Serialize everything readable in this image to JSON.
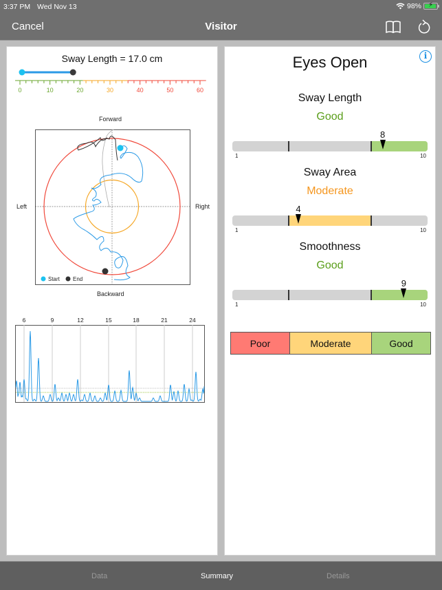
{
  "status_bar": {
    "time": "3:37 PM",
    "date": "Wed Nov 13",
    "battery": "98%",
    "icons": [
      "wifi-icon",
      "battery-charging-icon"
    ]
  },
  "nav": {
    "cancel": "Cancel",
    "title": "Visitor",
    "icons": [
      "book-icon",
      "refresh-icon"
    ]
  },
  "left_panel": {
    "sway_title": "Sway Length = 17.0 cm",
    "slider": {
      "min": 0,
      "max": 60,
      "start": 0,
      "value": 17.0
    },
    "scale": {
      "ticks": [
        {
          "label": "0",
          "value": 0,
          "color": "#6aa62e"
        },
        {
          "label": "10",
          "value": 10,
          "color": "#6aa62e"
        },
        {
          "label": "20",
          "value": 20,
          "color": "#6aa62e"
        },
        {
          "label": "30",
          "value": 30,
          "color": "#f5a623"
        },
        {
          "label": "40",
          "value": 40,
          "color": "#f0483a"
        },
        {
          "label": "50",
          "value": 50,
          "color": "#f0483a"
        },
        {
          "label": "60",
          "value": 60,
          "color": "#f0483a"
        }
      ],
      "zones": [
        {
          "from": 0,
          "to": 21,
          "color": "#6aa62e"
        },
        {
          "from": 21,
          "to": 36,
          "color": "#f5a623"
        },
        {
          "from": 36,
          "to": 62,
          "color": "#f0483a"
        }
      ]
    },
    "sway_plot": {
      "labels": {
        "top": "Forward",
        "bottom": "Backward",
        "left": "Left",
        "right": "Right"
      },
      "legend": {
        "start": "Start",
        "end": "End"
      },
      "colors": {
        "outer": "#f0483a",
        "inner": "#f5a623",
        "path": "#2b9ae6",
        "start": "#1cc2f0",
        "end": "#333333"
      }
    },
    "fft_chart": {
      "x_ticks": [
        "6",
        "9",
        "12",
        "15",
        "18",
        "21",
        "24"
      ],
      "line_color": "#2b9ae6"
    }
  },
  "right_panel": {
    "title": "Eyes Open",
    "info_icon": "i",
    "metrics": [
      {
        "name": "Sway Length",
        "rating": "Good",
        "rating_color": "#5a9e1a",
        "value": 8,
        "value_label": "8",
        "zone": "good",
        "min_label": "1",
        "max_label": "10"
      },
      {
        "name": "Sway Area",
        "rating": "Moderate",
        "rating_color": "#f5961e",
        "value": 4,
        "value_label": "4",
        "zone": "moderate",
        "min_label": "1",
        "max_label": "10"
      },
      {
        "name": "Smoothness",
        "rating": "Good",
        "rating_color": "#5a9e1a",
        "value": 9,
        "value_label": "9",
        "zone": "good",
        "min_label": "1",
        "max_label": "10"
      }
    ],
    "legend": [
      {
        "label": "Poor",
        "color": "#ff7a73"
      },
      {
        "label": "Moderate",
        "color": "#ffd57a"
      },
      {
        "label": "Good",
        "color": "#a8d47c"
      }
    ]
  },
  "tabs": [
    {
      "label": "Data",
      "active": false
    },
    {
      "label": "Summary",
      "active": true
    },
    {
      "label": "Details",
      "active": false
    }
  ]
}
